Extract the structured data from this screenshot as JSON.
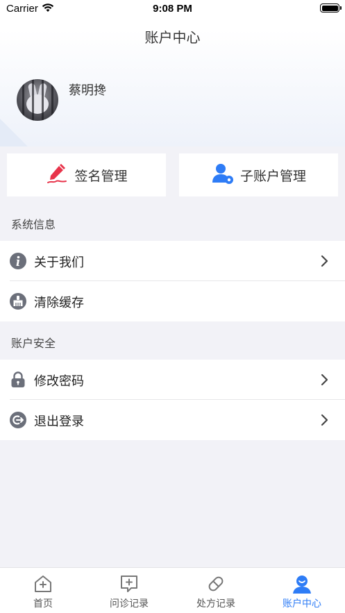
{
  "status_bar": {
    "carrier": "Carrier",
    "time": "9:08 PM"
  },
  "header": {
    "title": "账户中心"
  },
  "profile": {
    "name": "蔡明搀"
  },
  "quick_actions": [
    {
      "label": "签名管理",
      "icon": "signature-icon"
    },
    {
      "label": "子账户管理",
      "icon": "sub-account-icon"
    }
  ],
  "sections": {
    "system": {
      "title": "系统信息",
      "items": [
        {
          "label": "关于我们",
          "icon": "info-icon",
          "has_chevron": true
        },
        {
          "label": "清除缓存",
          "icon": "broom-icon",
          "has_chevron": false
        }
      ]
    },
    "security": {
      "title": "账户安全",
      "items": [
        {
          "label": "修改密码",
          "icon": "lock-icon",
          "has_chevron": true
        },
        {
          "label": "退出登录",
          "icon": "logout-icon",
          "has_chevron": true
        }
      ]
    }
  },
  "tabs": [
    {
      "label": "首页",
      "icon": "home-icon",
      "active": false
    },
    {
      "label": "问诊记录",
      "icon": "consult-icon",
      "active": false
    },
    {
      "label": "处方记录",
      "icon": "pill-icon",
      "active": false
    },
    {
      "label": "账户中心",
      "icon": "account-icon",
      "active": true
    }
  ],
  "colors": {
    "accent": "#2e7cf6",
    "signature_red": "#e8334a",
    "icon_gray": "#6b6f7a"
  }
}
